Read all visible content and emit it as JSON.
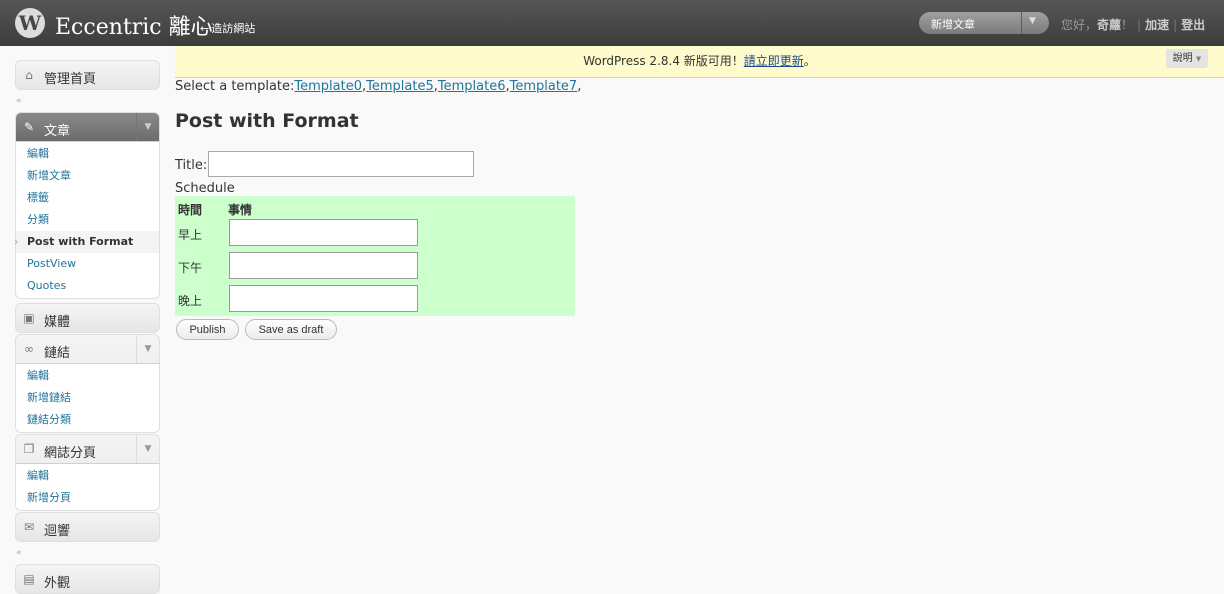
{
  "header": {
    "logo_glyph": "W",
    "site_title": "Eccentric 離心",
    "visit_site_arrow": "←",
    "visit_site_label": "造訪網站",
    "favorite_action": "新增文章",
    "favorite_arrow": "▼",
    "greeting": "您好，",
    "username": "奇蘿",
    "exclaim": "！",
    "separator": "|",
    "turbo": "加速",
    "logout": "登出"
  },
  "update_nag": {
    "text": "WordPress 2.8.4 新版可用！",
    "link": "請立即更新",
    "end": "。"
  },
  "help_tab": {
    "label": "說明",
    "arrow": "▼"
  },
  "sidebar": {
    "collapse_glyph": "«",
    "dashboard": {
      "label": "管理首頁",
      "icon": "home-icon",
      "glyph": "⌂"
    },
    "posts": {
      "label": "文章",
      "icon": "pin-icon",
      "glyph": "✎",
      "toggle": "▼",
      "items": [
        {
          "label": "編輯"
        },
        {
          "label": "新增文章"
        },
        {
          "label": "標籤"
        },
        {
          "label": "分類"
        },
        {
          "label": "Post with Format",
          "active": true
        },
        {
          "label": "PostView"
        },
        {
          "label": "Quotes"
        }
      ]
    },
    "media": {
      "label": "媒體",
      "icon": "media-icon",
      "glyph": "▣"
    },
    "links": {
      "label": "鏈結",
      "icon": "link-icon",
      "glyph": "∞",
      "toggle": "▼",
      "items": [
        {
          "label": "編輯"
        },
        {
          "label": "新增鏈結"
        },
        {
          "label": "鏈結分類"
        }
      ]
    },
    "pages": {
      "label": "網誌分頁",
      "icon": "pages-icon",
      "glyph": "❐",
      "toggle": "▼",
      "items": [
        {
          "label": "編輯"
        },
        {
          "label": "新增分頁"
        }
      ]
    },
    "comments": {
      "label": "迴響",
      "icon": "comment-icon",
      "glyph": "✉"
    },
    "appearance": {
      "label": "外觀",
      "icon": "appearance-icon",
      "glyph": "▤"
    }
  },
  "main": {
    "template_prefix": "Select a template:",
    "templates": [
      "Template0",
      "Template5",
      "Template6",
      "Template7"
    ],
    "comma": ",",
    "page_title": "Post with Format",
    "title_label": "Title:",
    "title_value": "",
    "schedule_label": "Schedule",
    "schedule": {
      "col_time": "時間",
      "col_event": "事情",
      "rows": [
        {
          "label": "早上",
          "value": ""
        },
        {
          "label": "下午",
          "value": ""
        },
        {
          "label": "晚上",
          "value": ""
        }
      ]
    },
    "publish_button": "Publish",
    "draft_button": "Save as draft"
  },
  "colors": {
    "header_bg": "#464646",
    "link": "#21759b",
    "nag_bg": "#fffbcc",
    "schedule_bg": "#ccffcc"
  }
}
